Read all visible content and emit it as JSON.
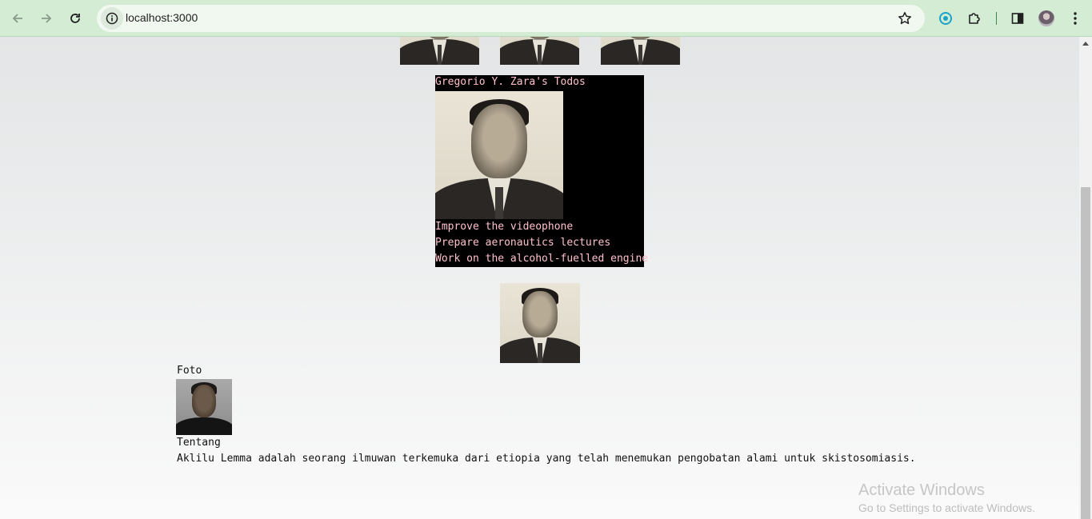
{
  "browser": {
    "url": "localhost:3000",
    "back_icon": "arrow-left-icon",
    "forward_icon": "arrow-right-icon",
    "reload_icon": "reload-icon",
    "site_info_icon": "info-icon",
    "bookmark_icon": "star-icon",
    "toolbar_icons": [
      "extension-logo-icon",
      "puzzle-icon",
      "side-panel-icon",
      "profile-avatar-icon",
      "kebab-menu-icon"
    ],
    "theme_color": "#d3ecd3"
  },
  "gallery": {
    "thumbnails": [
      {
        "alt": "portrait"
      },
      {
        "alt": "portrait"
      },
      {
        "alt": "portrait"
      }
    ]
  },
  "todo_card": {
    "title": "Gregorio Y. Zara's Todos",
    "background": "#000000",
    "text_color": "#ffc0cb",
    "items": [
      "Improve the videophone",
      "Prepare aeronautics lectures",
      "Work on the alcohol-fuelled engine"
    ]
  },
  "profile": {
    "photo_label": "Foto",
    "about_label": "Tentang",
    "about_text": "Aklilu Lemma adalah seorang ilmuwan terkemuka dari etiopia yang telah menemukan pengobatan alami untuk skistosomiasis."
  },
  "watermark": {
    "title": "Activate Windows",
    "subtitle": "Go to Settings to activate Windows."
  }
}
